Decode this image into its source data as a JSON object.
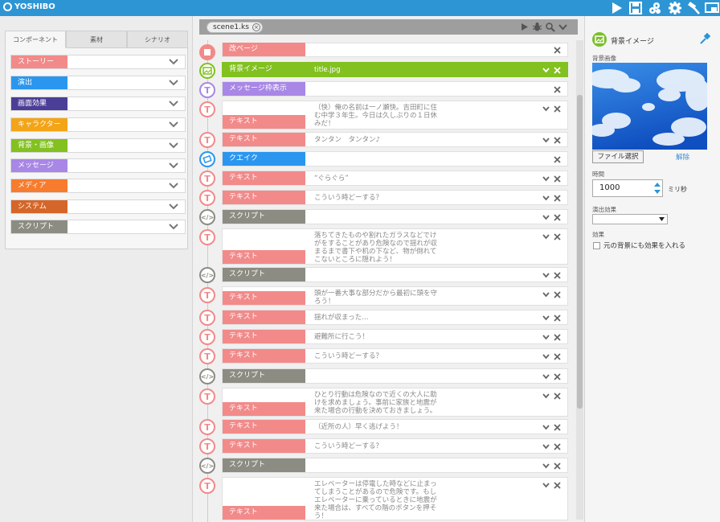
{
  "app": {
    "logo": "YOSHIBO"
  },
  "toolbar": {
    "icons": [
      "play-icon",
      "save-icon",
      "gear-group-icon",
      "settings-gear-icon",
      "hammer-icon",
      "preview-window-icon"
    ]
  },
  "left": {
    "tabs": [
      "コンポーネント",
      "素材",
      "シナリオ"
    ],
    "categories": [
      {
        "label": "ストーリー",
        "color": "#f28a8a"
      },
      {
        "label": "演出",
        "color": "#2a96ef"
      },
      {
        "label": "画面効果",
        "color": "#4a3e97"
      },
      {
        "label": "キャラクター",
        "color": "#f3a417"
      },
      {
        "label": "背景・画像",
        "color": "#82c11f"
      },
      {
        "label": "メッセージ",
        "color": "#a887e6"
      },
      {
        "label": "メディア",
        "color": "#f77c2e"
      },
      {
        "label": "システム",
        "color": "#d56629"
      },
      {
        "label": "スクリプト",
        "color": "#8c8c83"
      }
    ]
  },
  "center": {
    "file_tab": "scene1.ks",
    "rows": [
      {
        "label": "改ページ",
        "value": ""
      },
      {
        "label": "背景イメージ",
        "value": "title.jpg"
      },
      {
        "label": "メッセージ枠表示",
        "value": ""
      },
      {
        "label": "テキスト",
        "value": "（快）俺の名前は一ノ瀬快。吉田町に住む中学３年生。今日は久しぶりの１日休みだ！"
      },
      {
        "label": "テキスト",
        "value": "タンタン　タンタン♪"
      },
      {
        "label": "クエイク",
        "value": ""
      },
      {
        "label": "テキスト",
        "value": "“ぐらぐら”"
      },
      {
        "label": "テキスト",
        "value": "こういう時どーする？"
      },
      {
        "label": "スクリプト",
        "value": ""
      },
      {
        "label": "テキスト",
        "value": "落ちてきたものや割れたガラスなどでけがをすることがあり危険なので揺れが収まるまで書下や机の下など、物が倒れてこないところに隠れよう！"
      },
      {
        "label": "スクリプト",
        "value": ""
      },
      {
        "label": "テキスト",
        "value": "頭が一番大事な部分だから最初に頭を守ろう！"
      },
      {
        "label": "テキスト",
        "value": "揺れが収まった…"
      },
      {
        "label": "テキスト",
        "value": "避難所に行こう！"
      },
      {
        "label": "テキスト",
        "value": "こういう時どーする？"
      },
      {
        "label": "スクリプト",
        "value": ""
      },
      {
        "label": "テキスト",
        "value": "ひとり行動は危険なので近くの大人に助けを求めましょう。事前に家族と地震が来た場合の行動を決めておきましょう。"
      },
      {
        "label": "テキスト",
        "value": "（近所の人）早く逃げよう！"
      },
      {
        "label": "テキスト",
        "value": "こういう時どーする？"
      },
      {
        "label": "スクリプト",
        "value": ""
      },
      {
        "label": "テキスト",
        "value": "エレベーターは停電した時などに止まってしまうことがあるので危険です。もしエレベーターに乗っているときに地震が来た場合は、すべての階のボタンを押そう！"
      }
    ]
  },
  "right": {
    "title": "背景イメージ",
    "image_label": "背景画像",
    "file_button": "ファイル選択",
    "unset_link": "解除",
    "time_label": "時間",
    "time_value": "1000",
    "time_unit": "ミリ秒",
    "effect_label": "演出効果",
    "effect_value": "",
    "fx_label": "効果",
    "fx_checkbox_label": "元の背景にも効果を入れる"
  }
}
